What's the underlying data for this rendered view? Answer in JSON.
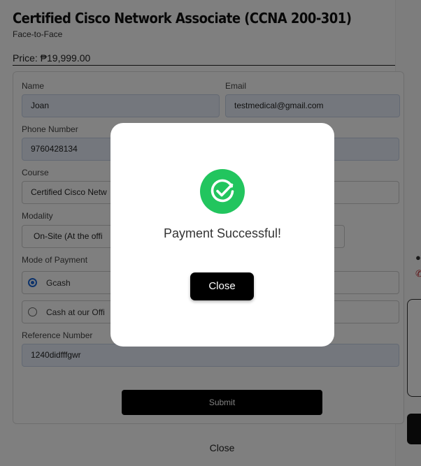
{
  "course": {
    "title": "Certified Cisco Network Associate (CCNA 200-301)",
    "subtitle": "Face-to-Face",
    "price": "Price: ₱19,999.00"
  },
  "form": {
    "name_label": "Name",
    "name_value": "Joan",
    "email_label": "Email",
    "email_value": "testmedical@gmail.com",
    "phone_label": "Phone Number",
    "phone_value": "9760428134",
    "course_label": "Course",
    "course_value": "Certified Cisco Netw",
    "modality_label": "Modality",
    "modality_value": "On-Site (At the offi",
    "payment_label": "Mode of Payment",
    "payment_options": [
      {
        "label": "Gcash",
        "selected": true
      },
      {
        "label": "Cash at our Offi",
        "selected": false
      }
    ],
    "reference_label": "Reference Number",
    "reference_value": "1240didfffgwr",
    "submit_label": "Submit"
  },
  "footer": {
    "close_label": "Close"
  },
  "modal": {
    "icon": "check-circle-icon",
    "message": "Payment Successful!",
    "close_label": "Close",
    "accent_color": "#22c55e"
  }
}
